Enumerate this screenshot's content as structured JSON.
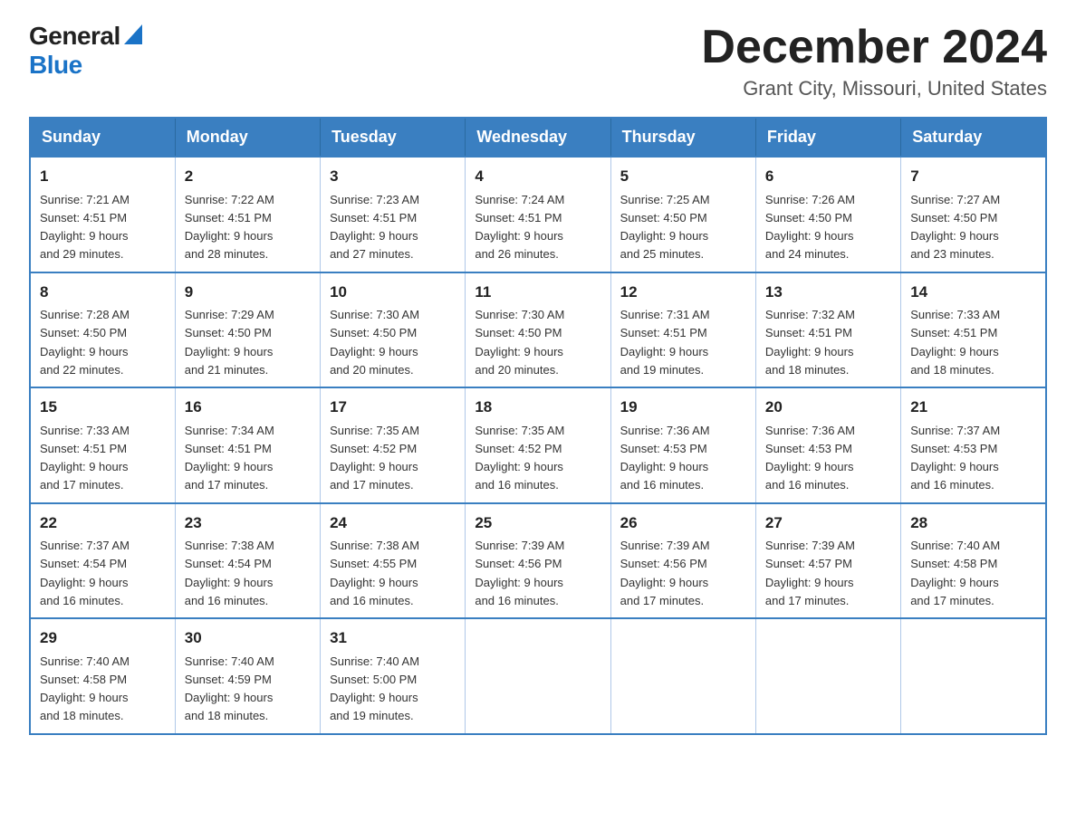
{
  "header": {
    "logo_general": "General",
    "logo_blue": "Blue",
    "month_title": "December 2024",
    "subtitle": "Grant City, Missouri, United States"
  },
  "days_of_week": [
    "Sunday",
    "Monday",
    "Tuesday",
    "Wednesday",
    "Thursday",
    "Friday",
    "Saturday"
  ],
  "weeks": [
    [
      {
        "num": "1",
        "sunrise": "7:21 AM",
        "sunset": "4:51 PM",
        "daylight": "9 hours and 29 minutes."
      },
      {
        "num": "2",
        "sunrise": "7:22 AM",
        "sunset": "4:51 PM",
        "daylight": "9 hours and 28 minutes."
      },
      {
        "num": "3",
        "sunrise": "7:23 AM",
        "sunset": "4:51 PM",
        "daylight": "9 hours and 27 minutes."
      },
      {
        "num": "4",
        "sunrise": "7:24 AM",
        "sunset": "4:51 PM",
        "daylight": "9 hours and 26 minutes."
      },
      {
        "num": "5",
        "sunrise": "7:25 AM",
        "sunset": "4:50 PM",
        "daylight": "9 hours and 25 minutes."
      },
      {
        "num": "6",
        "sunrise": "7:26 AM",
        "sunset": "4:50 PM",
        "daylight": "9 hours and 24 minutes."
      },
      {
        "num": "7",
        "sunrise": "7:27 AM",
        "sunset": "4:50 PM",
        "daylight": "9 hours and 23 minutes."
      }
    ],
    [
      {
        "num": "8",
        "sunrise": "7:28 AM",
        "sunset": "4:50 PM",
        "daylight": "9 hours and 22 minutes."
      },
      {
        "num": "9",
        "sunrise": "7:29 AM",
        "sunset": "4:50 PM",
        "daylight": "9 hours and 21 minutes."
      },
      {
        "num": "10",
        "sunrise": "7:30 AM",
        "sunset": "4:50 PM",
        "daylight": "9 hours and 20 minutes."
      },
      {
        "num": "11",
        "sunrise": "7:30 AM",
        "sunset": "4:50 PM",
        "daylight": "9 hours and 20 minutes."
      },
      {
        "num": "12",
        "sunrise": "7:31 AM",
        "sunset": "4:51 PM",
        "daylight": "9 hours and 19 minutes."
      },
      {
        "num": "13",
        "sunrise": "7:32 AM",
        "sunset": "4:51 PM",
        "daylight": "9 hours and 18 minutes."
      },
      {
        "num": "14",
        "sunrise": "7:33 AM",
        "sunset": "4:51 PM",
        "daylight": "9 hours and 18 minutes."
      }
    ],
    [
      {
        "num": "15",
        "sunrise": "7:33 AM",
        "sunset": "4:51 PM",
        "daylight": "9 hours and 17 minutes."
      },
      {
        "num": "16",
        "sunrise": "7:34 AM",
        "sunset": "4:51 PM",
        "daylight": "9 hours and 17 minutes."
      },
      {
        "num": "17",
        "sunrise": "7:35 AM",
        "sunset": "4:52 PM",
        "daylight": "9 hours and 17 minutes."
      },
      {
        "num": "18",
        "sunrise": "7:35 AM",
        "sunset": "4:52 PM",
        "daylight": "9 hours and 16 minutes."
      },
      {
        "num": "19",
        "sunrise": "7:36 AM",
        "sunset": "4:53 PM",
        "daylight": "9 hours and 16 minutes."
      },
      {
        "num": "20",
        "sunrise": "7:36 AM",
        "sunset": "4:53 PM",
        "daylight": "9 hours and 16 minutes."
      },
      {
        "num": "21",
        "sunrise": "7:37 AM",
        "sunset": "4:53 PM",
        "daylight": "9 hours and 16 minutes."
      }
    ],
    [
      {
        "num": "22",
        "sunrise": "7:37 AM",
        "sunset": "4:54 PM",
        "daylight": "9 hours and 16 minutes."
      },
      {
        "num": "23",
        "sunrise": "7:38 AM",
        "sunset": "4:54 PM",
        "daylight": "9 hours and 16 minutes."
      },
      {
        "num": "24",
        "sunrise": "7:38 AM",
        "sunset": "4:55 PM",
        "daylight": "9 hours and 16 minutes."
      },
      {
        "num": "25",
        "sunrise": "7:39 AM",
        "sunset": "4:56 PM",
        "daylight": "9 hours and 16 minutes."
      },
      {
        "num": "26",
        "sunrise": "7:39 AM",
        "sunset": "4:56 PM",
        "daylight": "9 hours and 17 minutes."
      },
      {
        "num": "27",
        "sunrise": "7:39 AM",
        "sunset": "4:57 PM",
        "daylight": "9 hours and 17 minutes."
      },
      {
        "num": "28",
        "sunrise": "7:40 AM",
        "sunset": "4:58 PM",
        "daylight": "9 hours and 17 minutes."
      }
    ],
    [
      {
        "num": "29",
        "sunrise": "7:40 AM",
        "sunset": "4:58 PM",
        "daylight": "9 hours and 18 minutes."
      },
      {
        "num": "30",
        "sunrise": "7:40 AM",
        "sunset": "4:59 PM",
        "daylight": "9 hours and 18 minutes."
      },
      {
        "num": "31",
        "sunrise": "7:40 AM",
        "sunset": "5:00 PM",
        "daylight": "9 hours and 19 minutes."
      },
      null,
      null,
      null,
      null
    ]
  ],
  "labels": {
    "sunrise": "Sunrise: ",
    "sunset": "Sunset: ",
    "daylight": "Daylight: "
  }
}
